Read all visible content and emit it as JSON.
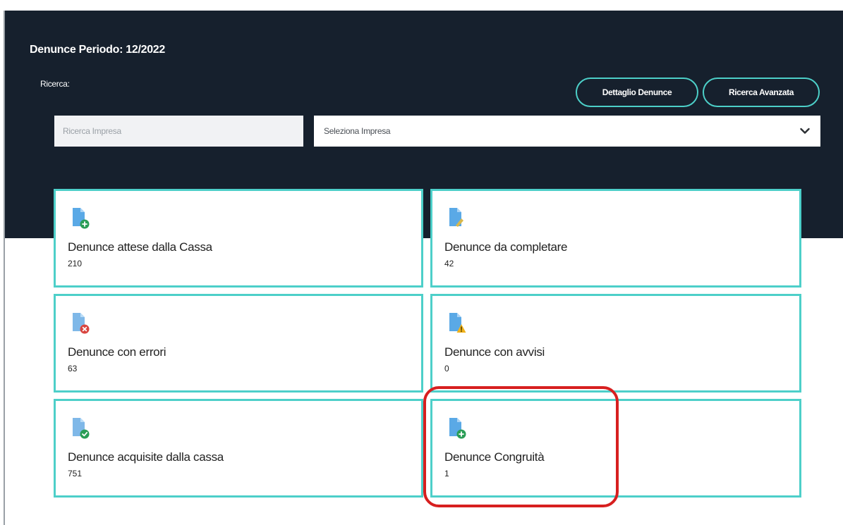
{
  "header": {
    "title": "Denunce Periodo: 12/2022",
    "search_label": "Ricerca:",
    "buttons": {
      "detail": "Dettaglio Denunce",
      "advanced": "Ricerca Avanzata"
    },
    "search_input": {
      "placeholder": "Ricerca Impresa",
      "value": ""
    },
    "select": {
      "selected": "Seleziona Impresa",
      "icon": "chevron-down-icon"
    },
    "background": "#16202d",
    "accent": "#4ccfc8"
  },
  "cards": [
    {
      "title": "Denunce attese dalla Cassa",
      "count": "210",
      "icon": "document-add-icon",
      "badge_color": "#2a9d56"
    },
    {
      "title": "Denunce da completare",
      "count": "42",
      "icon": "document-edit-icon",
      "badge_color": "#d9b84a"
    },
    {
      "title": "Denunce con errori",
      "count": "63",
      "icon": "document-error-icon",
      "badge_color": "#d9453f"
    },
    {
      "title": "Denunce con avvisi",
      "count": "0",
      "icon": "document-warning-icon",
      "badge_color": "#f0b21a"
    },
    {
      "title": "Denunce acquisite dalla cassa",
      "count": "751",
      "icon": "document-check-icon",
      "badge_color": "#2a9d56"
    },
    {
      "title": "Denunce Congruità",
      "count": "1",
      "icon": "document-add-icon",
      "badge_color": "#2a9d56"
    }
  ],
  "annotation": {
    "color": "#d71f1f"
  }
}
